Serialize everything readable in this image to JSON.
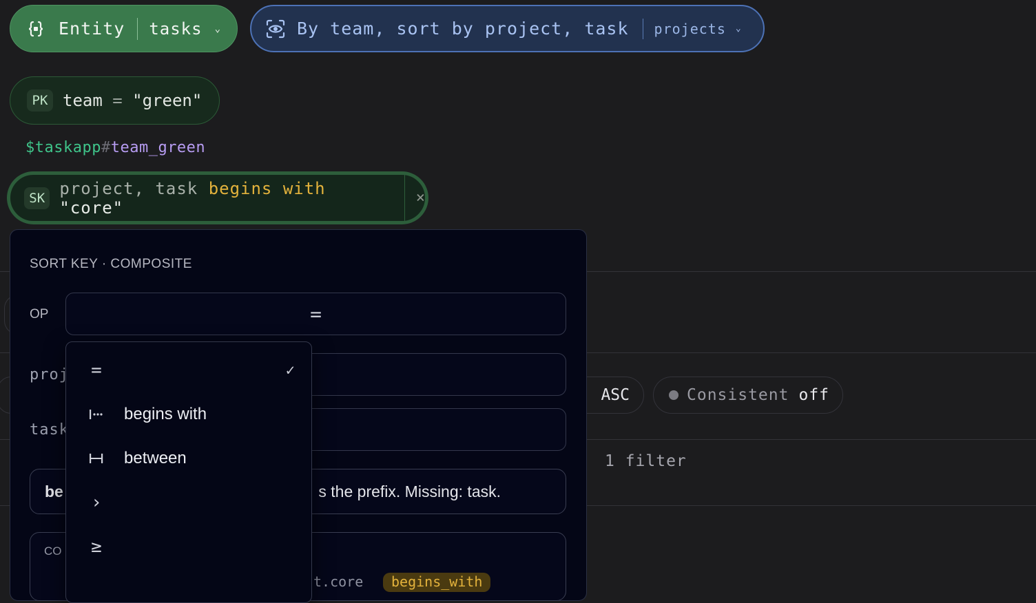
{
  "entity": {
    "label": "Entity",
    "value": "tasks",
    "icon": "braces-icon"
  },
  "index": {
    "label": "By team, sort by project, task",
    "value": "projects",
    "icon": "scan-eye-icon"
  },
  "partition_key": {
    "badge": "PK",
    "attr": "team",
    "eq": "=",
    "value": "\"green\""
  },
  "key_preview": {
    "prefix": "$taskapp",
    "hash": "#",
    "suffix": "team_green"
  },
  "sort_key": {
    "badge": "SK",
    "attrs": "project, task",
    "op": "begins with",
    "value": "\"core\"",
    "clear": "×"
  },
  "options": {
    "order": "ASC",
    "consistent_label": "Consistent",
    "consistent_value": "off",
    "filter_count": "1 filter"
  },
  "popover": {
    "title": "SORT KEY · COMPOSITE",
    "op_label": "OP",
    "op_value": "=",
    "field1_label": "proj",
    "field2_label": "task",
    "hint_bold": "be",
    "hint_text": "s the prefix. Missing: task.",
    "compiled_label": "CO",
    "compiled_frag": "t.core",
    "compiled_tag": "begins_with"
  },
  "dropdown": {
    "items": [
      {
        "icon": "equals-icon",
        "glyph": "=",
        "label": "",
        "selected": true
      },
      {
        "icon": "begins-with-icon",
        "glyph": "",
        "label": "begins with",
        "selected": false
      },
      {
        "icon": "between-icon",
        "glyph": "",
        "label": "between",
        "selected": false
      },
      {
        "icon": "greater-than-icon",
        "glyph": "›",
        "label": "",
        "selected": false
      },
      {
        "icon": "greater-equal-icon",
        "glyph": "≥",
        "label": "",
        "selected": false
      }
    ],
    "check": "✓"
  }
}
